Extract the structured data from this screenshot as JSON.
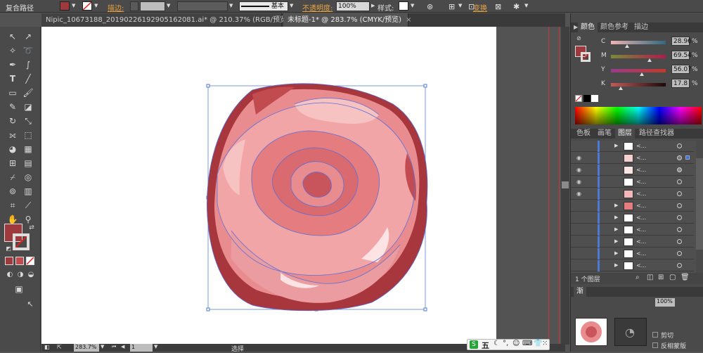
{
  "control_bar": {
    "object_type": "复合路径",
    "stroke_label": "描边:",
    "stroke_style": "基本",
    "opacity_label": "不透明度:",
    "opacity_value": "100%",
    "style_label": "样式:",
    "transform_label": "变换"
  },
  "tabs": [
    {
      "label": "Nipic_10673188_20190226192905162081.ai* @ 210.37% (RGB/预览)",
      "close": "×"
    },
    {
      "label": "未标题-1* @ 283.7% (CMYK/预览)",
      "close": "×"
    }
  ],
  "status": {
    "zoom": "283.7%",
    "page": "1",
    "tool": "选择"
  },
  "color_panel": {
    "tabs": [
      "颜色",
      "颜色参考",
      "描边"
    ],
    "channels": [
      {
        "name": "C",
        "value": "28.96",
        "unit": "%",
        "level": 0.29
      },
      {
        "name": "M",
        "value": "69.54",
        "unit": "%",
        "level": 0.7
      },
      {
        "name": "Y",
        "value": "56.07",
        "unit": "%",
        "level": 0.56
      },
      {
        "name": "K",
        "value": "17.8",
        "unit": "%",
        "level": 0.18
      }
    ],
    "fill_color": "#9e3a3d"
  },
  "layers_panel": {
    "tabs": [
      "色板",
      "画笔",
      "图层",
      "路径查找器"
    ],
    "layer_count": "1 个图层",
    "rows": [
      {
        "name": "<...",
        "expand": true
      },
      {
        "name": "<...",
        "expand": false,
        "selected": true
      },
      {
        "name": "<...",
        "expand": false
      },
      {
        "name": "<...",
        "expand": false
      },
      {
        "name": "<...",
        "expand": false
      },
      {
        "name": "<...",
        "expand": true
      },
      {
        "name": "<...",
        "expand": true
      },
      {
        "name": "<...",
        "expand": true
      },
      {
        "name": "<...",
        "expand": true
      },
      {
        "name": "<...",
        "expand": true
      },
      {
        "name": "<...",
        "expand": true
      }
    ]
  },
  "bottom_panel": {
    "tab": "渐",
    "opacity_value": "100%",
    "item1": "剪切",
    "item2": "反相蒙版"
  },
  "ime_bar": {
    "label": "五"
  },
  "colors": {
    "accent_orange": "#e8a341",
    "fill_red": "#9e3a3d",
    "selection_blue": "#4d79d6",
    "rose_light": "#f2a5a6",
    "rose_mid": "#e47c80",
    "rose_dark": "#a8363d"
  }
}
